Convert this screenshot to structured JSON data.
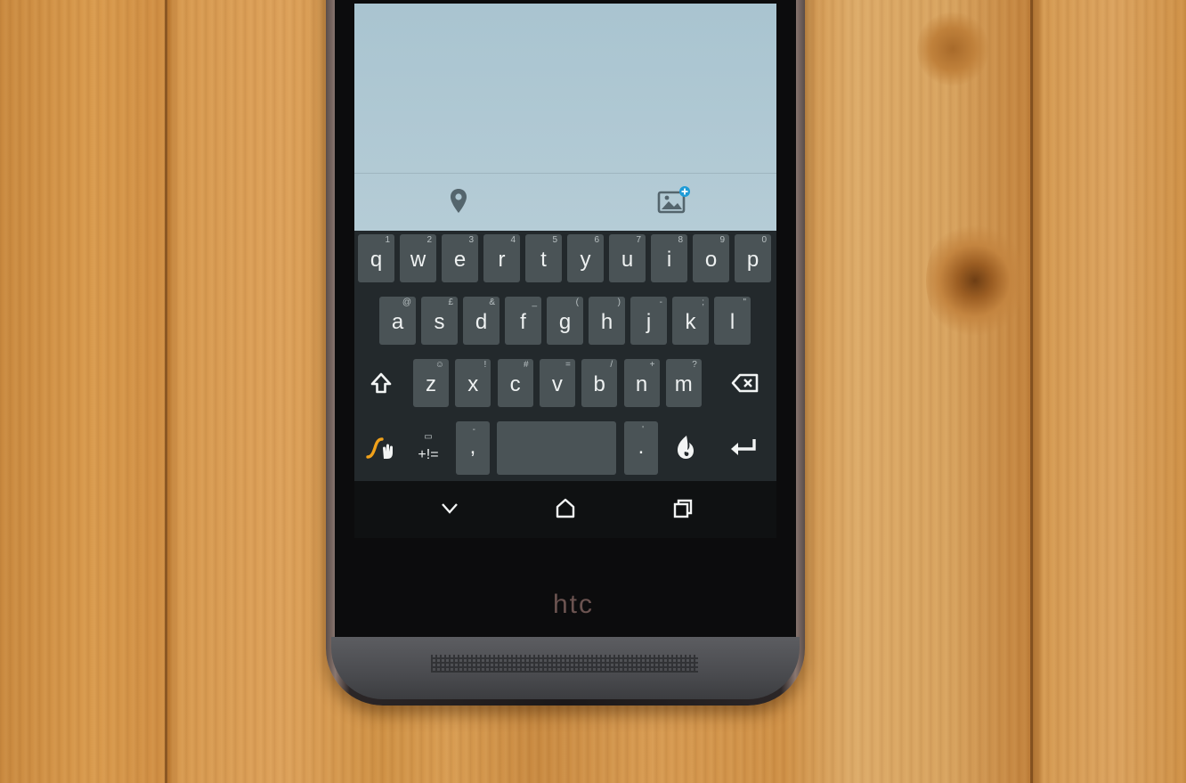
{
  "device": {
    "brand_logo": "htc"
  },
  "compose_toolbar": {
    "location_icon": "location-pin-icon",
    "photo_icon": "add-photo-icon",
    "accent_color": "#1e9bd7"
  },
  "keyboard": {
    "row1": [
      {
        "label": "q",
        "hint": "1"
      },
      {
        "label": "w",
        "hint": "2"
      },
      {
        "label": "e",
        "hint": "3"
      },
      {
        "label": "r",
        "hint": "4"
      },
      {
        "label": "t",
        "hint": "5"
      },
      {
        "label": "y",
        "hint": "6"
      },
      {
        "label": "u",
        "hint": "7"
      },
      {
        "label": "i",
        "hint": "8"
      },
      {
        "label": "o",
        "hint": "9"
      },
      {
        "label": "p",
        "hint": "0"
      }
    ],
    "row2": [
      {
        "label": "a",
        "hint": "@"
      },
      {
        "label": "s",
        "hint": "£"
      },
      {
        "label": "d",
        "hint": "&"
      },
      {
        "label": "f",
        "hint": "_"
      },
      {
        "label": "g",
        "hint": "("
      },
      {
        "label": "h",
        "hint": ")"
      },
      {
        "label": "j",
        "hint": "-"
      },
      {
        "label": "k",
        "hint": ";"
      },
      {
        "label": "l",
        "hint": "\""
      }
    ],
    "row3": [
      {
        "label": "z",
        "hint": "☺"
      },
      {
        "label": "x",
        "hint": "!"
      },
      {
        "label": "c",
        "hint": "#"
      },
      {
        "label": "v",
        "hint": "="
      },
      {
        "label": "b",
        "hint": "/"
      },
      {
        "label": "n",
        "hint": "+"
      },
      {
        "label": "m",
        "hint": "?"
      }
    ],
    "symbols_key": "+!=",
    "comma_key": ",",
    "comma_hint": "-",
    "period_key": ".",
    "period_hint": "'",
    "swype_color": "#f0a11a"
  },
  "navigation": {
    "back_icon": "chevron-down-icon",
    "home_icon": "home-icon",
    "recents_icon": "recent-apps-icon"
  }
}
